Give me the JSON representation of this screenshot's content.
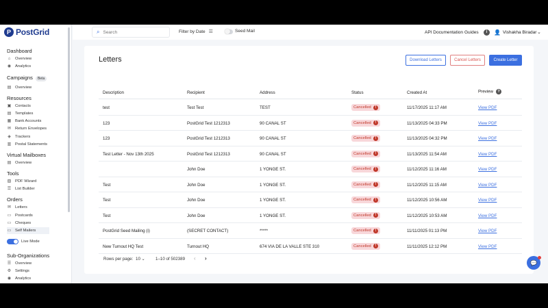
{
  "brand": {
    "mark": "P",
    "name": "PostGrid"
  },
  "sidebar": {
    "sections": [
      {
        "title": "Dashboard",
        "items": [
          {
            "label": "Overview",
            "icon": "home-icon"
          },
          {
            "label": "Analytics",
            "icon": "analytics-icon"
          }
        ]
      },
      {
        "title": "Campaigns",
        "badge": "Beta",
        "items": [
          {
            "label": "Overview",
            "icon": "overview-icon"
          }
        ]
      },
      {
        "title": "Resources",
        "items": [
          {
            "label": "Contacts",
            "icon": "contacts-icon"
          },
          {
            "label": "Templates",
            "icon": "templates-icon"
          },
          {
            "label": "Bank Accounts",
            "icon": "bank-icon"
          },
          {
            "label": "Return Envelopes",
            "icon": "envelope-icon"
          },
          {
            "label": "Trackers",
            "icon": "tracker-icon"
          },
          {
            "label": "Postal Statements",
            "icon": "statement-icon"
          }
        ]
      },
      {
        "title": "Virtual Mailboxes",
        "items": [
          {
            "label": "Overview",
            "icon": "overview-icon"
          }
        ]
      },
      {
        "title": "Tools",
        "items": [
          {
            "label": "PDF Wizard",
            "icon": "wizard-icon"
          },
          {
            "label": "List Builder",
            "icon": "list-icon"
          }
        ]
      },
      {
        "title": "Orders",
        "items": [
          {
            "label": "Letters",
            "icon": "letter-icon"
          },
          {
            "label": "Postcards",
            "icon": "postcard-icon"
          },
          {
            "label": "Cheques",
            "icon": "cheque-icon"
          },
          {
            "label": "Self Mailers",
            "icon": "mailer-icon"
          }
        ]
      }
    ],
    "live_mode_label": "Live Mode",
    "sub_org": {
      "title": "Sub-Organizations",
      "items": [
        {
          "label": "Overview",
          "icon": "overview-icon"
        },
        {
          "label": "Settings",
          "icon": "gear-icon"
        },
        {
          "label": "Analytics",
          "icon": "analytics-icon"
        }
      ]
    }
  },
  "topbar": {
    "search_placeholder": "Search",
    "filter_label": "Filter by Date",
    "seed_mail_label": "Seed Mail",
    "api_docs": "API Documentation",
    "guides": "Guides",
    "user_name": "Vishakha Biradar"
  },
  "page": {
    "title": "Letters",
    "download_btn": "Download Letters",
    "cancel_btn": "Cancel Letters",
    "create_btn": "Create Letter"
  },
  "table": {
    "headers": {
      "description": "Description",
      "recipient": "Recipient",
      "address": "Address",
      "status": "Status",
      "created_at": "Created At",
      "preview": "Preview"
    },
    "rows": [
      {
        "description": "test",
        "recipient": "Test Test",
        "address": "TEST",
        "status": "Cancelled",
        "created_at": "11/17/2025 11:17 AM",
        "preview": "View PDF"
      },
      {
        "description": "123",
        "recipient": "PostGrid Test 1212313",
        "address": "90 CANAL ST",
        "status": "Cancelled",
        "created_at": "11/13/2025 04:33 PM",
        "preview": "View PDF"
      },
      {
        "description": "123",
        "recipient": "PostGrid Test 1212313",
        "address": "90 CANAL ST",
        "status": "Cancelled",
        "created_at": "11/13/2025 04:32 PM",
        "preview": "View PDF"
      },
      {
        "description": "Test Letter - Nov 13th 2025",
        "recipient": "PostGrid Test 1212313",
        "address": "90 CANAL ST",
        "status": "Cancelled",
        "created_at": "11/13/2025 11:54 AM",
        "preview": "View PDF"
      },
      {
        "description": "",
        "recipient": "John Doe",
        "address": "1 YONGE ST.",
        "status": "Cancelled",
        "created_at": "11/12/2025 11:16 AM",
        "preview": "View PDF"
      },
      {
        "description": "Test",
        "recipient": "John Doe",
        "address": "1 YONGE ST.",
        "status": "Cancelled",
        "created_at": "11/12/2025 11:15 AM",
        "preview": "View PDF"
      },
      {
        "description": "Test",
        "recipient": "John Doe",
        "address": "1 YONGE ST.",
        "status": "Cancelled",
        "created_at": "11/12/2025 10:56 AM",
        "preview": "View PDF"
      },
      {
        "description": "Test",
        "recipient": "John Doe",
        "address": "1 YONGE ST.",
        "status": "Cancelled",
        "created_at": "11/12/2025 10:53 AM",
        "preview": "View PDF"
      },
      {
        "description": "PostGrid Seed Mailing (i)",
        "recipient": "(SECRET CONTACT)",
        "address": "*****",
        "status": "Cancelled",
        "created_at": "11/11/2025 01:13 PM",
        "preview": "View PDF"
      },
      {
        "description": "New Turnout HQ Test",
        "recipient": "Turnout HQ",
        "address": "674 VIA DE LA VALLE STE 310",
        "status": "Cancelled",
        "created_at": "11/11/2025 12:12 PM",
        "preview": "View PDF"
      }
    ]
  },
  "pagination": {
    "rows_per_page_label": "Rows per page:",
    "rows_per_page": "10",
    "range": "1–10 of 502389"
  },
  "colors": {
    "accent": "#3b6fe0",
    "danger": "#c0392b",
    "brand": "#1f3b8f"
  }
}
